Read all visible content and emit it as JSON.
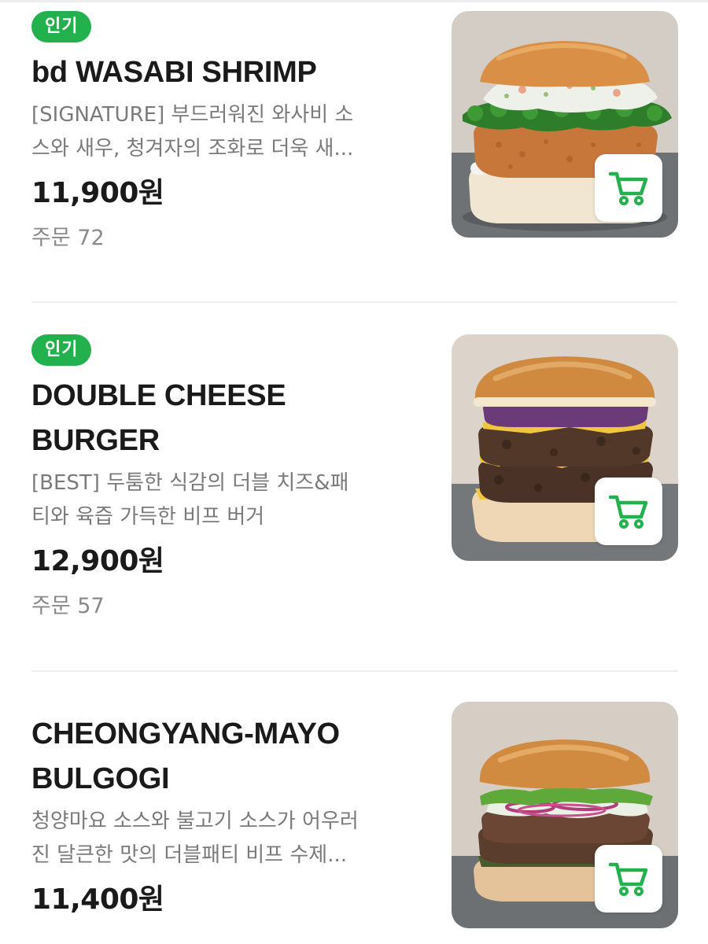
{
  "menu": {
    "items": [
      {
        "badge": "인기",
        "name_lines": [
          "bd WASABI SHRIMP"
        ],
        "desc_lines": [
          "[SIGNATURE] 부드러워진 와사비 소",
          "스와 새우, 청겨자의 조화로 더욱 새..."
        ],
        "price": "11,900원",
        "orders": "주문 72",
        "image": "burger-wasabi-shrimp",
        "cart_icon": "cart-icon"
      },
      {
        "badge": "인기",
        "name_lines": [
          "DOUBLE CHEESE",
          "BURGER"
        ],
        "desc_lines": [
          "[BEST] 두툼한 식감의 더블 치즈&패",
          "티와 육즙 가득한 비프 버거"
        ],
        "price": "12,900원",
        "orders": "주문 57",
        "image": "burger-double-cheese",
        "cart_icon": "cart-icon"
      },
      {
        "badge": "",
        "name_lines": [
          "CHEONGYANG-MAYO",
          "BULGOGI"
        ],
        "desc_lines": [
          "청양마요 소스와 불고기 소스가 어우러",
          "진 달큰한 맛의 더블패티 비프 수제..."
        ],
        "price": "11,400원",
        "orders": "",
        "image": "burger-cheongyang-mayo-bulgogi",
        "cart_icon": "cart-icon"
      }
    ]
  },
  "colors": {
    "badge_bg": "#22b14c",
    "cart_green": "#22b14c",
    "name_text": "#1a1a1a",
    "desc_text": "#7a7a7a"
  }
}
